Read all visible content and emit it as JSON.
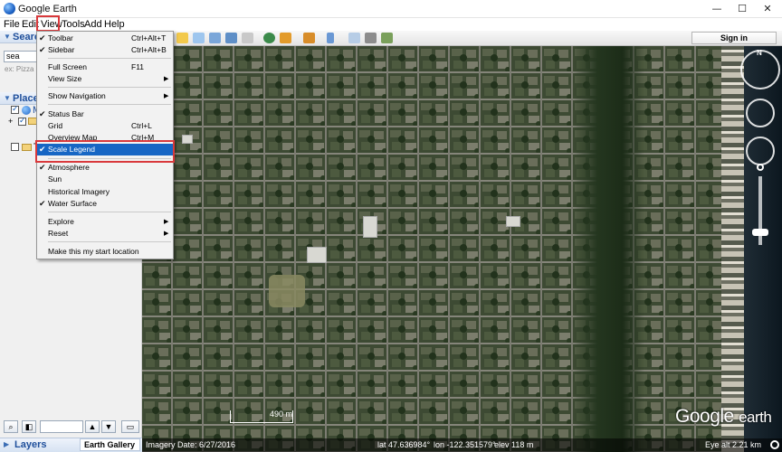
{
  "window": {
    "title": "Google Earth",
    "controls": {
      "minimize": "—",
      "maximize": "☐",
      "close": "✕"
    }
  },
  "menubar": {
    "file": "File",
    "edit": "Edit",
    "view": "View",
    "tools": "Tools",
    "add": "Add",
    "help": "Help"
  },
  "sidebar": {
    "search_title": "Search",
    "search_value": "sea",
    "search_hint": "ex: Pizza ne",
    "places_title": "Places",
    "places_partial": [
      "M",
      "T"
    ],
    "layers_title": "Layers",
    "earth_gallery": "Earth Gallery",
    "earth_gallery_arrow": "»"
  },
  "toolbar": {
    "signin": "Sign in"
  },
  "view_menu": {
    "items": [
      {
        "label": "Toolbar",
        "shortcut": "Ctrl+Alt+T",
        "checked": "✔"
      },
      {
        "label": "Sidebar",
        "shortcut": "Ctrl+Alt+B",
        "checked": "✔"
      },
      {
        "label": "Full Screen",
        "shortcut": "F11",
        "checked": ""
      },
      {
        "label": "View Size",
        "shortcut": "",
        "checked": "",
        "arrow": "▶"
      },
      {
        "label": "Show Navigation",
        "shortcut": "",
        "checked": "",
        "arrow": "▶"
      },
      {
        "label": "Status Bar",
        "shortcut": "",
        "checked": "✔"
      },
      {
        "label": "Grid",
        "shortcut": "Ctrl+L",
        "checked": ""
      },
      {
        "label": "Overview Map",
        "shortcut": "Ctrl+M",
        "checked": ""
      },
      {
        "label": "Scale Legend",
        "shortcut": "",
        "checked": "✔"
      },
      {
        "label": "Atmosphere",
        "shortcut": "",
        "checked": "✔"
      },
      {
        "label": "Sun",
        "shortcut": "",
        "checked": ""
      },
      {
        "label": "Historical Imagery",
        "shortcut": "",
        "checked": ""
      },
      {
        "label": "Water Surface",
        "shortcut": "",
        "checked": "✔"
      },
      {
        "label": "Explore",
        "shortcut": "",
        "checked": "",
        "arrow": "▶"
      },
      {
        "label": "Reset",
        "shortcut": "",
        "checked": "",
        "arrow": "▶"
      },
      {
        "label": "Make this my start location",
        "shortcut": "",
        "checked": ""
      }
    ]
  },
  "map": {
    "scale_label": "490 m",
    "logo_google": "Google",
    "logo_earth": "earth",
    "compass_n": "N",
    "status": {
      "imagery_date": "Imagery Date: 6/27/2016",
      "lat": "lat  47.636984°",
      "lon": "lon -122.351579°",
      "elev": "elev  118 m",
      "eye_alt": "Eye alt   2.21 km"
    }
  },
  "colors": {
    "highlight": "#1766c4",
    "annotation_red": "#d9393c"
  }
}
